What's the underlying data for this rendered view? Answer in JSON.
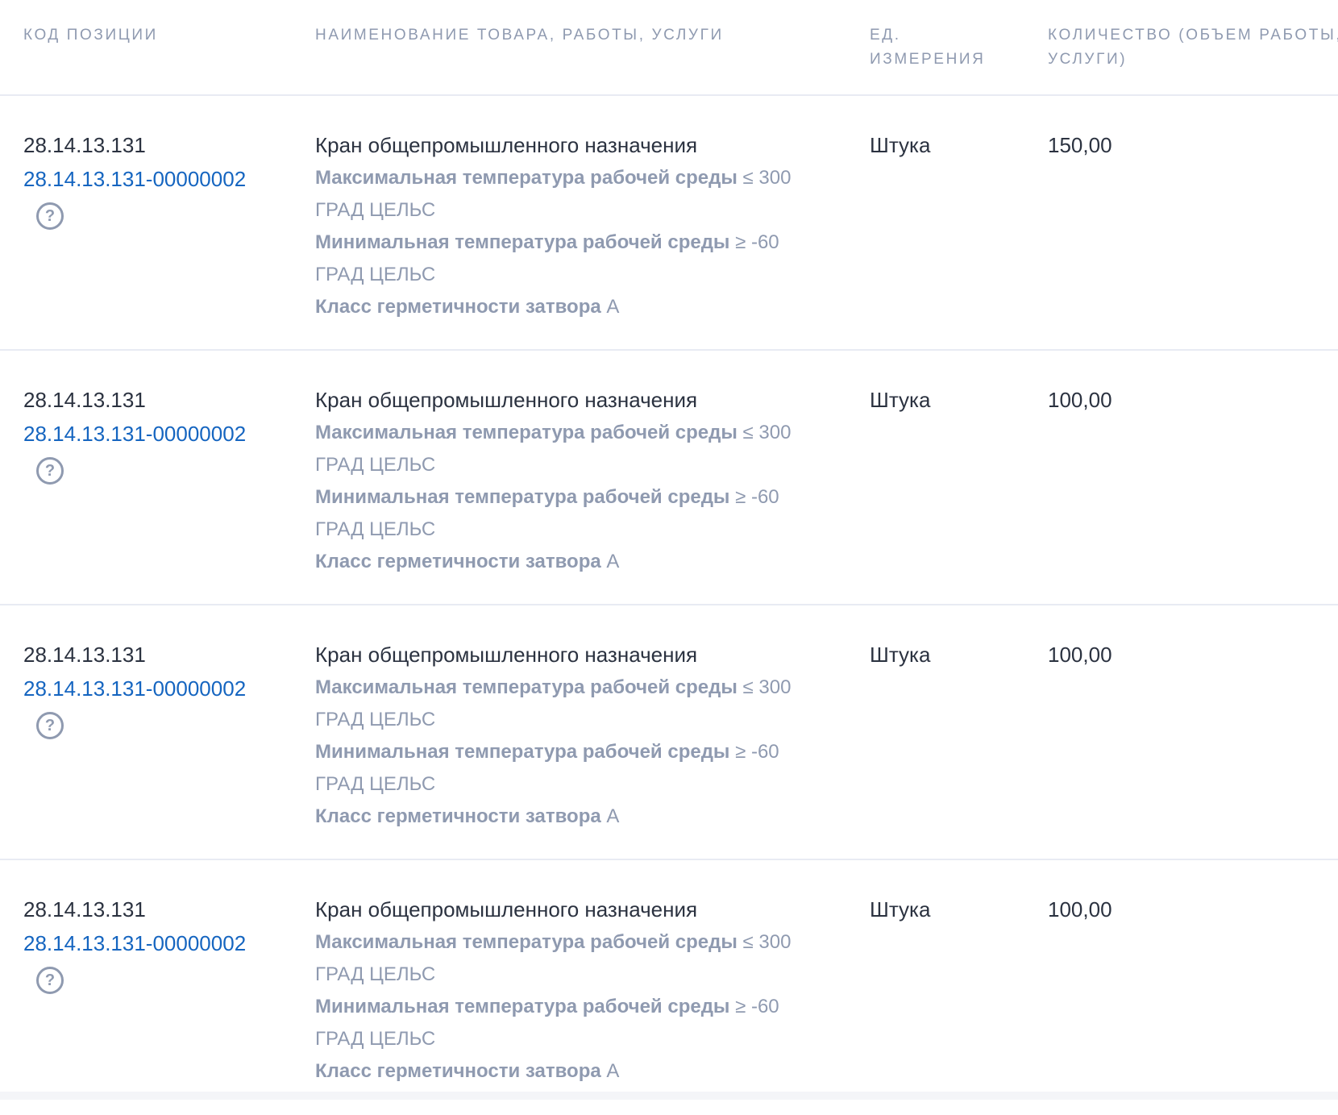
{
  "header": {
    "code": "КОД ПОЗИЦИИ",
    "name": "НАИМЕНОВАНИЕ ТОВАРА, РАБОТЫ, УСЛУГИ",
    "unit": "ЕД. ИЗМЕРЕНИЯ",
    "qty": "КОЛИЧЕСТВО (ОБЪЕМ РАБОТЫ, УСЛУГИ)"
  },
  "rows": [
    {
      "code": "28.14.13.131",
      "code_link": "28.14.13.131-00000002",
      "name": "Кран общепромышленного назначения",
      "attrs": [
        {
          "label": "Максимальная температура рабочей среды",
          "value": "≤ 300 ГРАД ЦЕЛЬС"
        },
        {
          "label": "Минимальная температура рабочей среды",
          "value": "≥ -60 ГРАД ЦЕЛЬС"
        },
        {
          "label": "Класс герметичности затвора",
          "value": "А"
        }
      ],
      "unit": "Штука",
      "qty": "150,00"
    },
    {
      "code": "28.14.13.131",
      "code_link": "28.14.13.131-00000002",
      "name": "Кран общепромышленного назначения",
      "attrs": [
        {
          "label": "Максимальная температура рабочей среды",
          "value": "≤ 300 ГРАД ЦЕЛЬС"
        },
        {
          "label": "Минимальная температура рабочей среды",
          "value": "≥ -60 ГРАД ЦЕЛЬС"
        },
        {
          "label": "Класс герметичности затвора",
          "value": "А"
        }
      ],
      "unit": "Штука",
      "qty": "100,00"
    },
    {
      "code": "28.14.13.131",
      "code_link": "28.14.13.131-00000002",
      "name": "Кран общепромышленного назначения",
      "attrs": [
        {
          "label": "Максимальная температура рабочей среды",
          "value": "≤ 300 ГРАД ЦЕЛЬС"
        },
        {
          "label": "Минимальная температура рабочей среды",
          "value": "≥ -60 ГРАД ЦЕЛЬС"
        },
        {
          "label": "Класс герметичности затвора",
          "value": "А"
        }
      ],
      "unit": "Штука",
      "qty": "100,00"
    },
    {
      "code": "28.14.13.131",
      "code_link": "28.14.13.131-00000002",
      "name": "Кран общепромышленного назначения",
      "attrs": [
        {
          "label": "Максимальная температура рабочей среды",
          "value": "≤ 300 ГРАД ЦЕЛЬС"
        },
        {
          "label": "Минимальная температура рабочей среды",
          "value": "≥ -60 ГРАД ЦЕЛЬС"
        },
        {
          "label": "Класс герметичности затвора",
          "value": "А"
        }
      ],
      "unit": "Штука",
      "qty": "100,00"
    }
  ]
}
